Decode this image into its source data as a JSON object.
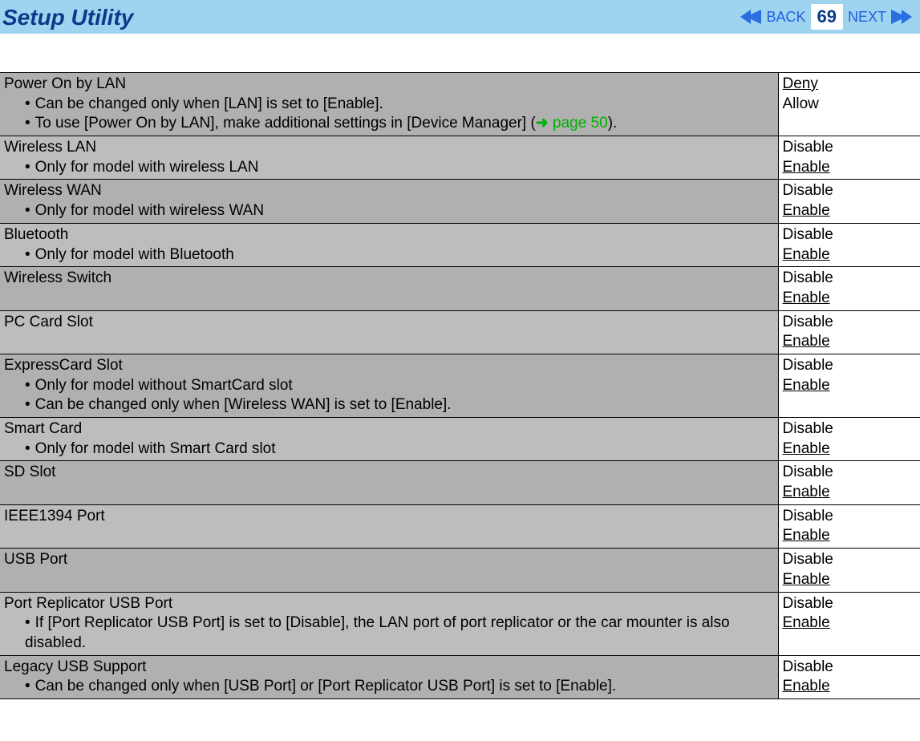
{
  "header": {
    "title": "Setup Utility",
    "back_label": "BACK",
    "next_label": "NEXT",
    "page_number": "69"
  },
  "rows": [
    {
      "name": "Power On by LAN",
      "notes": [
        {
          "prefix": "Can be changed only when [LAN] is set to [Enable].",
          "link": null,
          "suffix": null
        },
        {
          "prefix": "To use [Power On by LAN], make additional settings in [Device Manager] (",
          "link": "page 50",
          "suffix": ")."
        }
      ],
      "options": [
        "Deny",
        "Allow"
      ],
      "default_index": 0
    },
    {
      "name": "Wireless LAN",
      "notes": [
        {
          "prefix": "Only for model with wireless LAN",
          "link": null,
          "suffix": null
        }
      ],
      "options": [
        "Disable",
        "Enable"
      ],
      "default_index": 1
    },
    {
      "name": "Wireless WAN",
      "notes": [
        {
          "prefix": "Only for model with wireless WAN",
          "link": null,
          "suffix": null
        }
      ],
      "options": [
        "Disable",
        "Enable"
      ],
      "default_index": 1
    },
    {
      "name": "Bluetooth",
      "notes": [
        {
          "prefix": "Only for model with Bluetooth",
          "link": null,
          "suffix": null
        }
      ],
      "options": [
        "Disable",
        "Enable"
      ],
      "default_index": 1
    },
    {
      "name": "Wireless Switch",
      "notes": [],
      "options": [
        "Disable",
        "Enable"
      ],
      "default_index": 1
    },
    {
      "name": "PC Card Slot",
      "notes": [],
      "options": [
        "Disable",
        "Enable"
      ],
      "default_index": 1
    },
    {
      "name": "ExpressCard Slot",
      "notes": [
        {
          "prefix": "Only for model without SmartCard slot",
          "link": null,
          "suffix": null
        },
        {
          "prefix": "Can be changed only when [Wireless WAN] is set to [Enable].",
          "link": null,
          "suffix": null
        }
      ],
      "options": [
        "Disable",
        "Enable"
      ],
      "default_index": 1
    },
    {
      "name": "Smart Card",
      "notes": [
        {
          "prefix": "Only for model with Smart Card slot",
          "link": null,
          "suffix": null
        }
      ],
      "options": [
        "Disable",
        "Enable"
      ],
      "default_index": 1
    },
    {
      "name": "SD Slot",
      "notes": [],
      "options": [
        "Disable",
        "Enable"
      ],
      "default_index": 1
    },
    {
      "name": "IEEE1394 Port",
      "notes": [],
      "options": [
        "Disable",
        "Enable"
      ],
      "default_index": 1
    },
    {
      "name": "USB Port",
      "notes": [],
      "options": [
        "Disable",
        "Enable"
      ],
      "default_index": 1
    },
    {
      "name": "Port Replicator USB Port",
      "notes": [
        {
          "prefix": "If [Port Replicator USB Port] is set to [Disable], the LAN port of port replicator or the car mounter is also disabled.",
          "link": null,
          "suffix": null
        }
      ],
      "options": [
        "Disable",
        "Enable"
      ],
      "default_index": 1
    },
    {
      "name": "Legacy USB Support",
      "notes": [
        {
          "prefix": "Can be changed only when [USB Port] or [Port Replicator USB Port] is set to [Enable].",
          "link": null,
          "suffix": null
        }
      ],
      "options": [
        "Disable",
        "Enable"
      ],
      "default_index": 1
    }
  ]
}
